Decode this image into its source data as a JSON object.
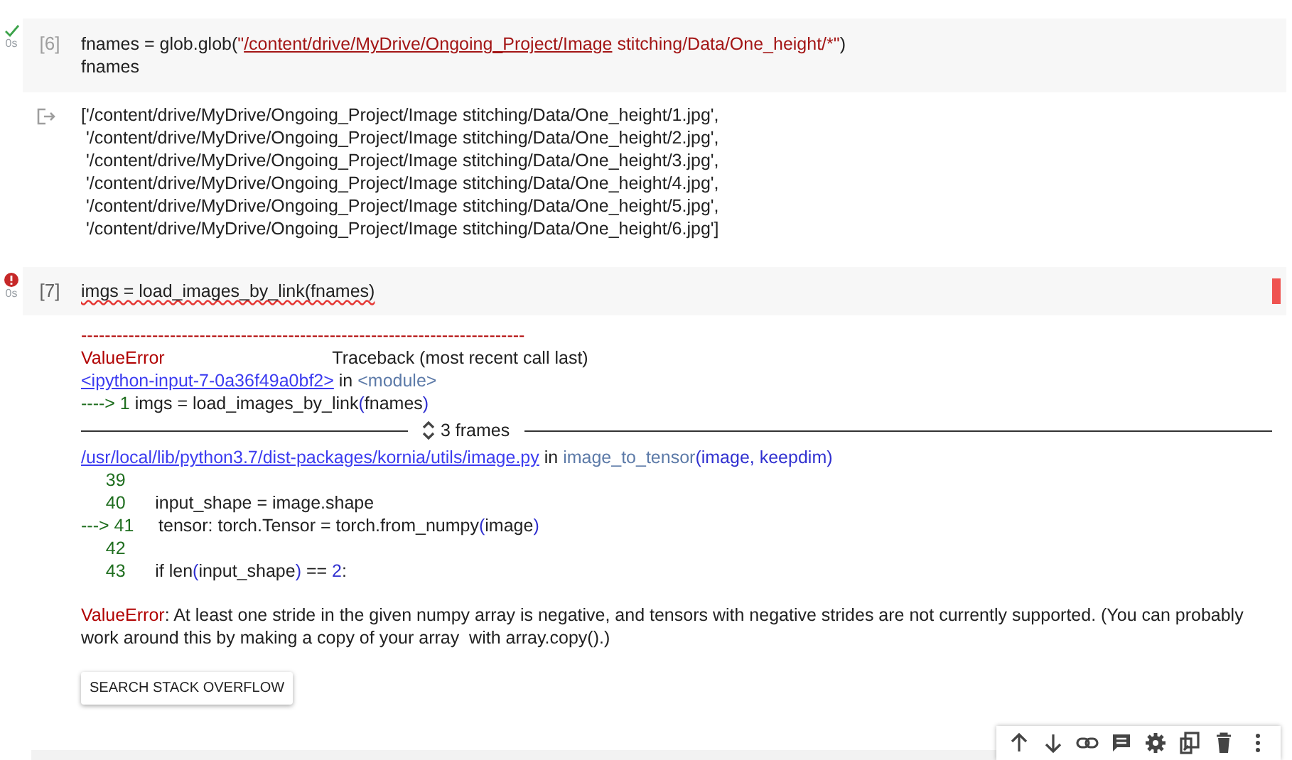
{
  "cells": [
    {
      "error": false,
      "time": "0s",
      "count": "[6]",
      "code": [
        [
          {
            "t": "fnames = glob.glob(",
            "kind": "plain"
          },
          {
            "t": "\"",
            "kind": "string"
          },
          {
            "t": "/content/drive/MyDrive/Ongoing_Project/Image",
            "kind": "stringlink"
          },
          {
            "t": " stitching/Data/One_height/*\"",
            "kind": "string"
          },
          {
            "t": ")",
            "kind": "plain"
          }
        ],
        [
          {
            "t": "fnames",
            "kind": "plain"
          }
        ]
      ],
      "output": [
        {
          "kind": "text",
          "segments": [
            {
              "t": "['/content/drive/MyDrive/Ongoing_Project/Image stitching/Data/One_height/1.jpg',",
              "kind": "plain"
            }
          ]
        },
        {
          "kind": "text",
          "segments": [
            {
              "t": " '/content/drive/MyDrive/Ongoing_Project/Image stitching/Data/One_height/2.jpg',",
              "kind": "plain"
            }
          ]
        },
        {
          "kind": "text",
          "segments": [
            {
              "t": " '/content/drive/MyDrive/Ongoing_Project/Image stitching/Data/One_height/3.jpg',",
              "kind": "plain"
            }
          ]
        },
        {
          "kind": "text",
          "segments": [
            {
              "t": " '/content/drive/MyDrive/Ongoing_Project/Image stitching/Data/One_height/4.jpg',",
              "kind": "plain"
            }
          ]
        },
        {
          "kind": "text",
          "segments": [
            {
              "t": " '/content/drive/MyDrive/Ongoing_Project/Image stitching/Data/One_height/5.jpg',",
              "kind": "plain"
            }
          ]
        },
        {
          "kind": "text",
          "segments": [
            {
              "t": " '/content/drive/MyDrive/Ongoing_Project/Image stitching/Data/One_height/6.jpg']",
              "kind": "plain"
            }
          ]
        }
      ]
    },
    {
      "error": true,
      "time": "0s",
      "count": "[7]",
      "code": [
        [
          {
            "t": "imgs = load_images_by_link(fnames)",
            "kind": "squiggle"
          }
        ]
      ],
      "output": [
        {
          "kind": "text",
          "segments": [
            {
              "t": "---------------------------------------------------------------------------",
              "kind": "err"
            }
          ]
        },
        {
          "kind": "text",
          "segments": [
            {
              "t": "ValueError",
              "kind": "err"
            },
            {
              "t": "                                  Traceback (most recent call last)",
              "kind": "plain"
            }
          ]
        },
        {
          "kind": "text",
          "segments": [
            {
              "t": "<ipython-input-7-0a36f49a0bf2>",
              "kind": "link"
            },
            {
              "t": " in ",
              "kind": "plain"
            },
            {
              "t": "<module>",
              "kind": "dim"
            }
          ]
        },
        {
          "kind": "text",
          "segments": [
            {
              "t": "----> 1 ",
              "kind": "green"
            },
            {
              "t": "imgs = load_images_by_link",
              "kind": "plain"
            },
            {
              "t": "(",
              "kind": "paren"
            },
            {
              "t": "fnames",
              "kind": "plain"
            },
            {
              "t": ")",
              "kind": "paren"
            }
          ]
        },
        {
          "kind": "frames",
          "label": "3 frames"
        },
        {
          "kind": "text",
          "segments": [
            {
              "t": "/usr/local/lib/python3.7/dist-packages/kornia/utils/image.py",
              "kind": "link"
            },
            {
              "t": " in ",
              "kind": "plain"
            },
            {
              "t": "image_to_tensor",
              "kind": "dim"
            },
            {
              "t": "(image, keepdim)",
              "kind": "paren"
            }
          ]
        },
        {
          "kind": "text",
          "segments": [
            {
              "t": "     39",
              "kind": "green"
            }
          ]
        },
        {
          "kind": "text",
          "segments": [
            {
              "t": "     40",
              "kind": "green"
            },
            {
              "t": "      input_shape = image.shape",
              "kind": "plain"
            }
          ]
        },
        {
          "kind": "text",
          "segments": [
            {
              "t": "---> 41",
              "kind": "green"
            },
            {
              "t": "     tensor: torch.Tensor = torch.from_numpy",
              "kind": "plain"
            },
            {
              "t": "(",
              "kind": "paren"
            },
            {
              "t": "image",
              "kind": "plain"
            },
            {
              "t": ")",
              "kind": "paren"
            }
          ]
        },
        {
          "kind": "text",
          "segments": [
            {
              "t": "     42",
              "kind": "green"
            }
          ]
        },
        {
          "kind": "text",
          "segments": [
            {
              "t": "     43",
              "kind": "green"
            },
            {
              "t": "      if len",
              "kind": "plain"
            },
            {
              "t": "(",
              "kind": "paren"
            },
            {
              "t": "input_shape",
              "kind": "plain"
            },
            {
              "t": ")",
              "kind": "paren"
            },
            {
              "t": " == ",
              "kind": "plain"
            },
            {
              "t": "2",
              "kind": "paren"
            },
            {
              "t": ":",
              "kind": "plain"
            }
          ]
        },
        {
          "kind": "message",
          "segments": [
            {
              "t": "ValueError",
              "kind": "err"
            },
            {
              "t": ": At least one stride in the given numpy array is negative, and tensors with negative strides are not currently supported. (You can probably work around this by making a copy of your array  with array.copy().)",
              "kind": "plain"
            }
          ]
        }
      ],
      "button": "SEARCH STACK OVERFLOW"
    }
  ]
}
